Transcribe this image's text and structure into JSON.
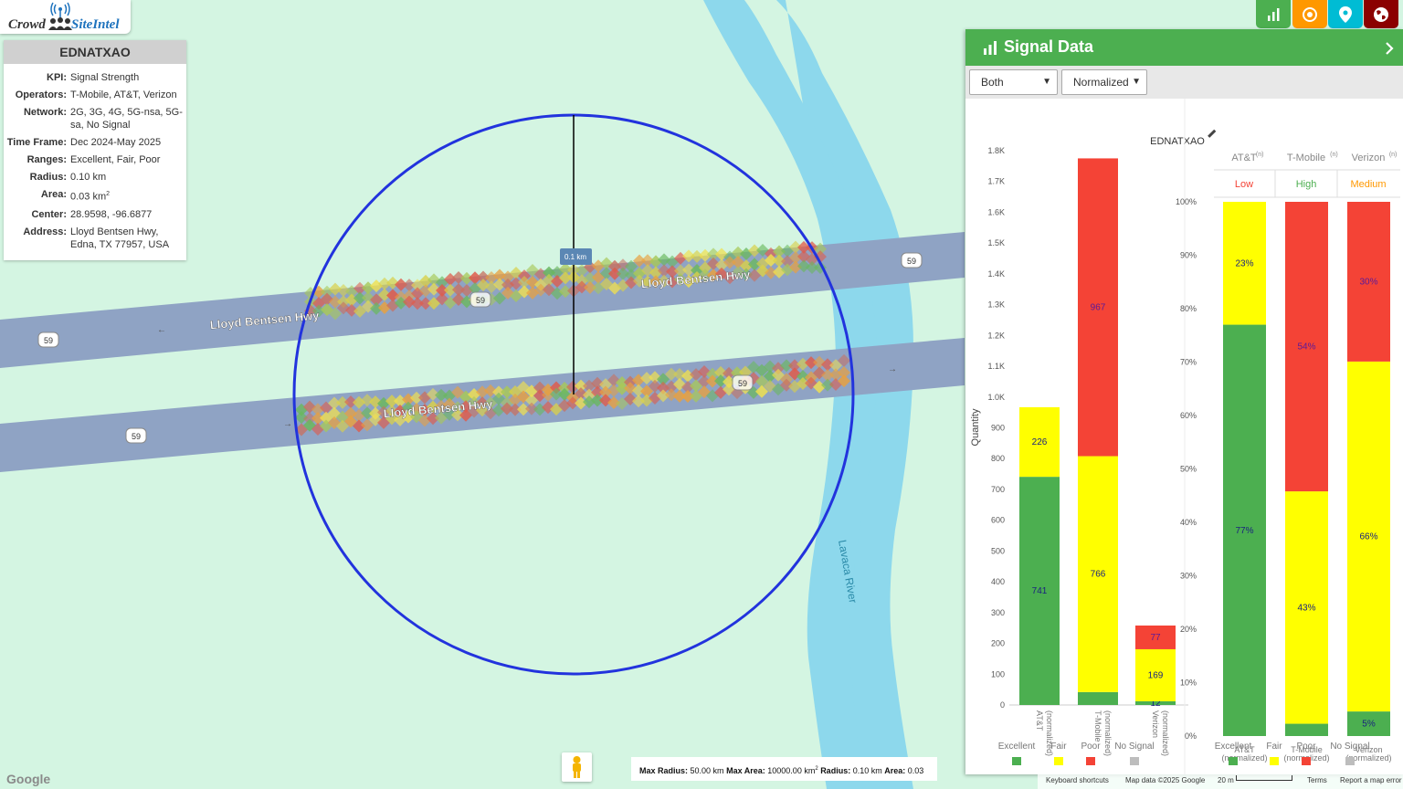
{
  "logo": {
    "crowd": "Crowd",
    "siteintel": "SiteIntel"
  },
  "info": {
    "title": "EDNATXAO",
    "rows": [
      {
        "k": "KPI:",
        "v": "Signal Strength"
      },
      {
        "k": "Operators:",
        "v": "T-Mobile, AT&T, Verizon"
      },
      {
        "k": "Network:",
        "v": "2G, 3G, 4G, 5G-nsa, 5G-sa, No Signal"
      },
      {
        "k": "Time Frame:",
        "v": "Dec 2024-May 2025"
      },
      {
        "k": "Ranges:",
        "v": "Excellent, Fair, Poor"
      },
      {
        "k": "Radius:",
        "v": "0.10 km"
      },
      {
        "k": "Area:",
        "v": "0.03 km",
        "sup": "2"
      },
      {
        "k": "Center:",
        "v": "28.9598, -96.6877"
      },
      {
        "k": "Address:",
        "v": "Lloyd Bentsen Hwy, Edna, TX 77957, USA"
      }
    ]
  },
  "map": {
    "road_labels": [
      "Lloyd Bentsen Hwy",
      "Lloyd Bentsen Hwy",
      "Lloyd Bentsen Hwy"
    ],
    "shield": "59",
    "river": "Lavaca River",
    "radius_label": "0.1 km",
    "colors": {
      "land": "#d4f5e2",
      "river": "#8dd8ec",
      "road": "#8fa3c4",
      "circle": "#2233dd"
    }
  },
  "scale_box": {
    "max_radius_label": "Max Radius:",
    "max_radius": "50.00 km",
    "max_area_label": "Max Area:",
    "max_area": "10000.00 km",
    "radius_label": "Radius:",
    "radius": "0.10 km",
    "area_label": "Area:",
    "area": "0.03 km"
  },
  "footer": {
    "google": "Google",
    "keyboard": "Keyboard shortcuts",
    "mapdata": "Map data ©2025 Google",
    "scale": "20 m",
    "terms": "Terms",
    "report": "Report a map error"
  },
  "toolbar": {
    "icons": [
      "chart-icon",
      "target-icon",
      "map-pin-icon",
      "globe-icon"
    ],
    "colors": [
      "#4caf50",
      "#ff9800",
      "#00bcd4",
      "#8b0000"
    ]
  },
  "panel": {
    "title": "Signal Data",
    "filter_select": "Both",
    "mode_select": "Normalized",
    "site_label": "EDNATXAO"
  },
  "chart_data": [
    {
      "type": "bar",
      "stacked": true,
      "title": "EDNATXAO",
      "ylabel": "Quantity",
      "ylim": [
        0,
        1800
      ],
      "yticks": [
        "0",
        "100",
        "200",
        "300",
        "400",
        "500",
        "600",
        "700",
        "800",
        "900",
        "1.0K",
        "1.1K",
        "1.2K",
        "1.3K",
        "1.4K",
        "1.5K",
        "1.6K",
        "1.7K",
        "1.8K"
      ],
      "categories": [
        "AT&T (normalized)",
        "T-Mobile (normalized)",
        "Verizon (normalized)"
      ],
      "series": [
        {
          "name": "Excellent",
          "color": "#4caf50",
          "values": [
            741,
            42,
            12
          ]
        },
        {
          "name": "Fair",
          "color": "#ffff00",
          "values": [
            226,
            766,
            169
          ]
        },
        {
          "name": "Poor",
          "color": "#f44336",
          "values": [
            0,
            967,
            77
          ]
        },
        {
          "name": "No Signal",
          "color": "#bdbdbd",
          "values": [
            0,
            0,
            0
          ]
        }
      ],
      "data_labels": [
        [
          "741",
          "226",
          ""
        ],
        [
          "",
          "766",
          "967"
        ],
        [
          "12",
          "169",
          "77"
        ]
      ],
      "legend": "bottom"
    },
    {
      "type": "bar",
      "stacked": true,
      "normalized": true,
      "ylim": [
        0,
        100
      ],
      "yticks": [
        "0%",
        "10%",
        "20%",
        "30%",
        "40%",
        "50%",
        "60%",
        "70%",
        "80%",
        "90%",
        "100%"
      ],
      "categories": [
        "AT&T (normalized)",
        "T-Mobile (normalized)",
        "Verizon (normalized)"
      ],
      "header": [
        "AT&T",
        "T-Mobile",
        "Verizon"
      ],
      "header_sup": "(n)",
      "ratings": [
        {
          "text": "Low",
          "color": "#f44336"
        },
        {
          "text": "High",
          "color": "#4caf50"
        },
        {
          "text": "Medium",
          "color": "#ff9800"
        }
      ],
      "series": [
        {
          "name": "Excellent",
          "color": "#4caf50",
          "values": [
            77,
            2.3,
            4.6
          ]
        },
        {
          "name": "Fair",
          "color": "#ffff00",
          "values": [
            23,
            43.5,
            65.5
          ]
        },
        {
          "name": "Poor",
          "color": "#f44336",
          "values": [
            0,
            54.2,
            29.9
          ]
        },
        {
          "name": "No Signal",
          "color": "#bdbdbd",
          "values": [
            0,
            0,
            0
          ]
        }
      ],
      "data_labels": [
        [
          "77%",
          "23%",
          ""
        ],
        [
          "",
          "43%",
          "54%"
        ],
        [
          "5%",
          "66%",
          "30%"
        ]
      ],
      "legend": "bottom"
    }
  ]
}
